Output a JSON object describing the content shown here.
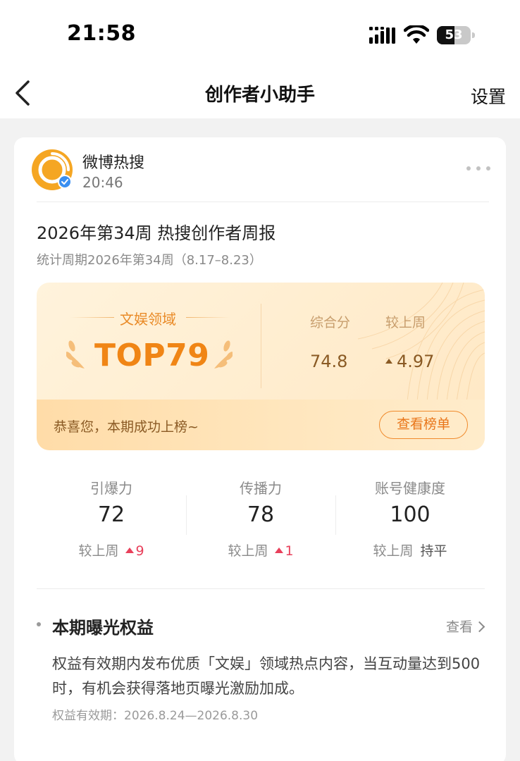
{
  "status_bar": {
    "time": "21:58",
    "battery": "53",
    "battery_level": 0.53
  },
  "nav": {
    "title": "创作者小助手",
    "settings_label": "设置"
  },
  "post": {
    "author": "微博热搜",
    "time": "20:46",
    "title": "2026年第34周 热搜创作者周报",
    "period": "统计周期2026年第34周（8.17–8.23）"
  },
  "rank": {
    "category": "文娱领域",
    "rank": "TOP79",
    "score_label": "综合分",
    "score": "74.8",
    "change_label": "较上周",
    "change": "4.97",
    "congrats": "恭喜您，本期成功上榜~",
    "view_button": "查看榜单"
  },
  "metrics": [
    {
      "label": "引爆力",
      "value": "72",
      "change_label": "较上周",
      "change": "9"
    },
    {
      "label": "传播力",
      "value": "78",
      "change_label": "较上周",
      "change": "1"
    },
    {
      "label": "账号健康度",
      "value": "100",
      "change_label": "较上周",
      "change": "持平"
    }
  ],
  "benefit": {
    "title": "本期曝光权益",
    "view_label": "查看",
    "description": "权益有效期内发布优质「文娱」领域热点内容，当互动量达到500时，有机会获得落地页曝光激励加成。",
    "validity": "权益有效期：2026.8.24—2026.8.30"
  },
  "colors": {
    "accent": "#f08515",
    "up_red": "#e8405b",
    "brand_dark": "#8a5a24"
  }
}
